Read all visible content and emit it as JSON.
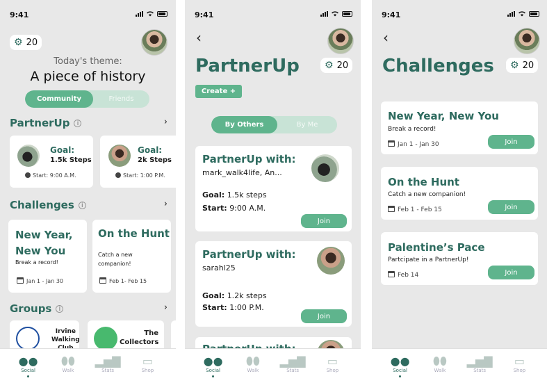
{
  "status_time": "9:41",
  "coins": "20",
  "screen1": {
    "theme_label": "Today's theme:",
    "theme_title": "A piece of history",
    "toggle": [
      "Community",
      "Friends"
    ],
    "partnerup_title": "PartnerUp",
    "partner_cards": [
      {
        "goal_label": "Goal:",
        "goal": "1.5k Steps",
        "start": "Start: 9:00 A.M."
      },
      {
        "goal_label": "Goal:",
        "goal": "2k Steps",
        "start": "Start: 1:00 P.M."
      }
    ],
    "challenges_title": "Challenges",
    "challenge_cards": [
      {
        "title_1": "New Year,",
        "title_2": "New You",
        "desc": "Break a record!",
        "date": "Jan 1 - Jan 30"
      },
      {
        "title_1": "On the Hunt",
        "desc_1": "Catch a new",
        "desc_2": "companion!",
        "date": "Feb 1- Feb 15"
      }
    ],
    "groups_title": "Groups",
    "groups": [
      {
        "name_1": "Irvine",
        "name_2": "Walking",
        "name_3": "Club"
      },
      {
        "name_1": "The",
        "name_2": "Collectors"
      }
    ]
  },
  "screen2": {
    "title": "PartnerUp",
    "create_button": "Create +",
    "toggle": [
      "By Others",
      "By Me"
    ],
    "cards": [
      {
        "header": "PartnerUp with:",
        "users": "mark_walk4life, An...",
        "goal_label": "Goal:",
        "goal": "1.5k steps",
        "start_label": "Start:",
        "start": "9:00 A.M.",
        "join": "Join"
      },
      {
        "header": "PartnerUp with:",
        "users": "sarahl25",
        "goal_label": "Goal:",
        "goal": "1.2k steps",
        "start_label": "Start:",
        "start": "1:00 P.M.",
        "join": "Join"
      },
      {
        "header": "PartnerUp with:"
      }
    ]
  },
  "screen3": {
    "title": "Challenges",
    "cards": [
      {
        "title": "New Year, New You",
        "desc": "Break a record!",
        "date": "Jan 1 - Jan 30",
        "join": "Join"
      },
      {
        "title": "On the Hunt",
        "desc": "Catch a new companion!",
        "date": "Feb 1 - Feb 15",
        "join": "Join"
      },
      {
        "title": "Palentine’s Pace",
        "desc": "Partcipate in a PartnerUp!",
        "date": "Feb 14",
        "join": "Join"
      }
    ]
  },
  "tabs": [
    {
      "label": "Social",
      "icon": "people-icon"
    },
    {
      "label": "Walk",
      "icon": "footprints-icon"
    },
    {
      "label": "Stats",
      "icon": "bar-chart-icon"
    },
    {
      "label": "Shop",
      "icon": "store-icon"
    }
  ],
  "colors": {
    "accent": "#2e6b5f",
    "button": "#5fb48d",
    "toggle_bg": "#c8e3d6"
  }
}
